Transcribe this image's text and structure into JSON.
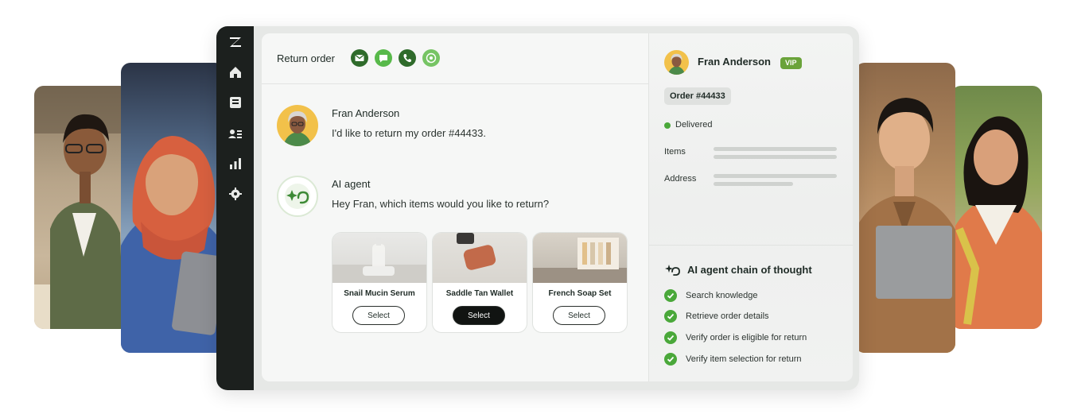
{
  "header": {
    "title": "Return order",
    "channels": [
      "email-channel",
      "chat-channel",
      "phone-channel",
      "whatsapp-channel"
    ]
  },
  "colors": {
    "rail": "#1c201e",
    "channel_dark": "#2f6b2b",
    "channel_light": "#58b94a",
    "vip": "#6aa33a",
    "check": "#4aa83a"
  },
  "conversation": {
    "customer_message": {
      "sender": "Fran Anderson",
      "text": "I'd like to return my order #44433."
    },
    "ai_message": {
      "sender": "AI agent",
      "text": "Hey Fran, which items would you like to return?"
    },
    "products": [
      {
        "name": "Snail Mucin Serum",
        "button": "Select",
        "selected": false
      },
      {
        "name": "Saddle Tan Wallet",
        "button": "Select",
        "selected": true
      },
      {
        "name": "French Soap Set",
        "button": "Select",
        "selected": false
      }
    ]
  },
  "customer": {
    "name": "Fran Anderson",
    "badge": "VIP",
    "order_chip": "Order #44433",
    "status": "Delivered",
    "fields": [
      "Items",
      "Address"
    ]
  },
  "chain_of_thought": {
    "title": "AI agent chain of thought",
    "steps": [
      "Search knowledge",
      "Retrieve order details",
      "Verify order is eligible for return",
      "Verify item selection for return"
    ]
  }
}
